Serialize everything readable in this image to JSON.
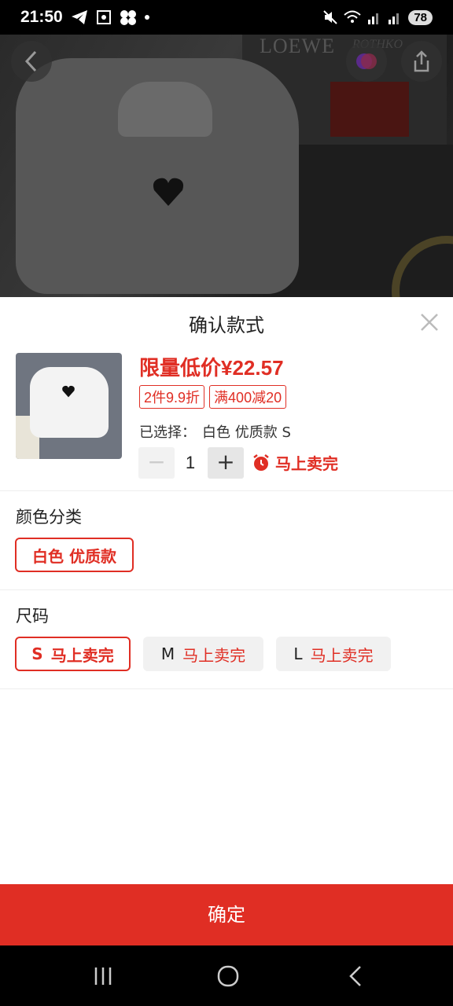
{
  "status_bar": {
    "time": "21:50",
    "battery": "78"
  },
  "hero": {
    "poster_brand": "LOEWE",
    "poster_artist": "ROTHKO"
  },
  "sheet": {
    "title": "确认款式",
    "price": "限量低价¥22.57",
    "tags": [
      "2件9.9折",
      "满400减20"
    ],
    "selected_label": "已选择：",
    "selected_value": "白色 优质款 S",
    "quantity": "1",
    "qty_minus": "−",
    "qty_plus": "+",
    "stock_warning": "马上卖完"
  },
  "color_section": {
    "title": "颜色分类",
    "options": [
      {
        "label": "白色 优质款",
        "selected": true
      }
    ]
  },
  "size_section": {
    "title": "尺码",
    "options": [
      {
        "size": "S",
        "note": "马上卖完",
        "selected": true
      },
      {
        "size": "M",
        "note": "马上卖完",
        "selected": false
      },
      {
        "size": "L",
        "note": "马上卖完",
        "selected": false
      }
    ]
  },
  "confirm_button": "确定",
  "colors": {
    "accent": "#e02e24",
    "confirm_bg": "#e02e24"
  }
}
